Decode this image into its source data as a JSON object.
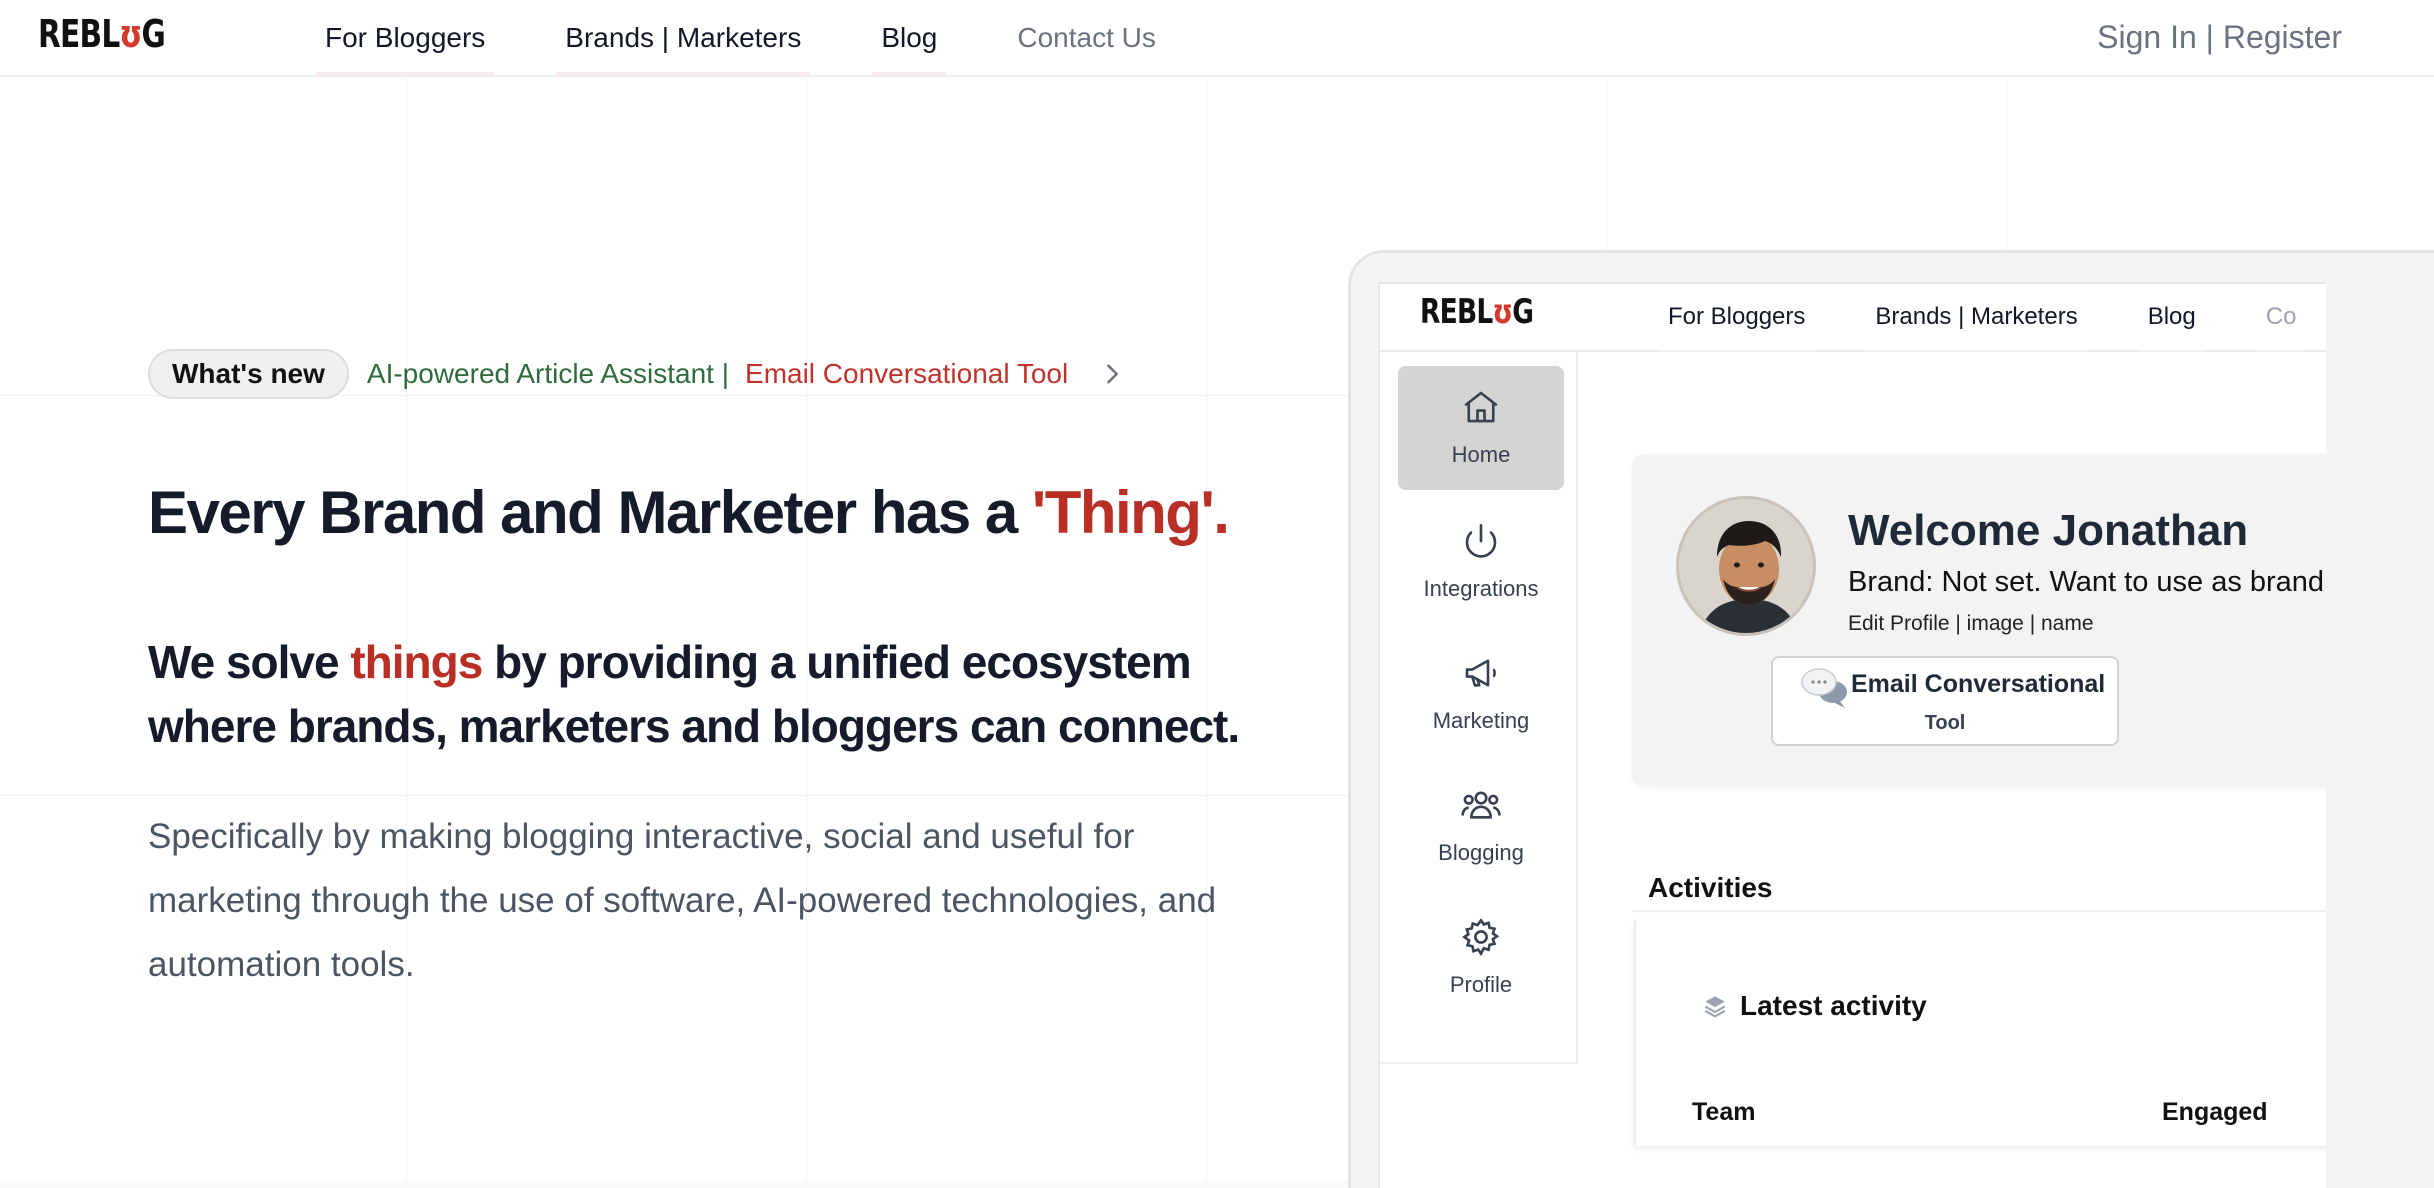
{
  "nav": {
    "logo_pre": "REBL",
    "logo_u": "ʊ",
    "logo_post": "G",
    "links": [
      "For Bloggers",
      "Brands | Marketers",
      "Blog",
      "Contact Us"
    ],
    "signin": "Sign In | Register"
  },
  "hero": {
    "whats_new": "What's new",
    "announce_green": "AI-powered Article Assistant |",
    "announce_red": "Email Conversational Tool",
    "h1_main": "Every Brand and Marketer has a ",
    "h1_accent": "'Thing'.",
    "h2_pre": "We solve ",
    "h2_accent": "things",
    "h2_post": " by providing a unified ecosystem where brands, marketers and bloggers can connect.",
    "lead": "Specifically by making blogging interactive, social and useful for marketing through the use of software, AI-powered technologies, and automation tools."
  },
  "mockup": {
    "logo_pre": "REBL",
    "logo_u": "ʊ",
    "logo_post": "G",
    "links": [
      "For Bloggers",
      "Brands | Marketers",
      "Blog",
      "Co"
    ],
    "sidebar": [
      {
        "label": "Home",
        "icon": "home-icon",
        "active": true
      },
      {
        "label": "Integrations",
        "icon": "power-icon",
        "active": false
      },
      {
        "label": "Marketing",
        "icon": "megaphone-icon",
        "active": false
      },
      {
        "label": "Blogging",
        "icon": "users-icon",
        "active": false
      },
      {
        "label": "Profile",
        "icon": "gear-icon",
        "active": false
      }
    ],
    "welcome": "Welcome Jonathan",
    "brand_line": "Brand: Not set. Want to use as brand c",
    "edit_line": "Edit Profile | image | name",
    "tool_line1": "Email Conversational",
    "tool_line2": "Tool",
    "activities": "Activities",
    "latest": "Latest activity",
    "col_team": "Team",
    "col_engaged": "Engaged"
  },
  "colors": {
    "accent_red": "#b92f25",
    "green": "#2f6b3b",
    "active_sidebar": "#d6d4d2"
  }
}
